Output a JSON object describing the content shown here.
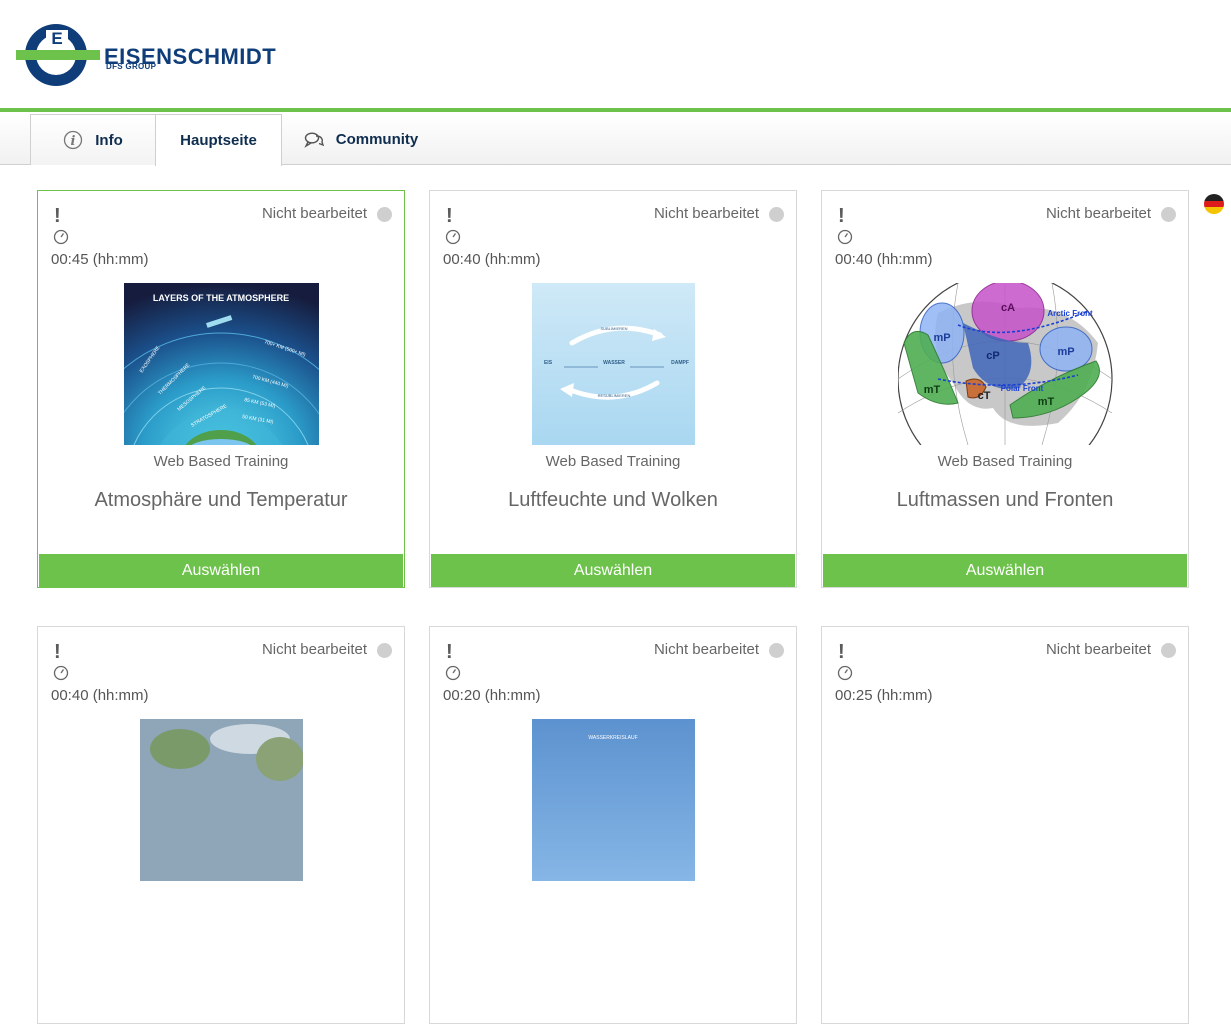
{
  "header": {
    "logo_text": "EISENSCHMIDT",
    "logo_subtext": "DFS GROUP"
  },
  "tabs": [
    {
      "label": "Info",
      "icon": "info-icon"
    },
    {
      "label": "Hauptseite",
      "icon": ""
    },
    {
      "label": "Community",
      "icon": "chat-icon"
    }
  ],
  "language_flag": "de-flag-icon",
  "cards": [
    {
      "duration": "00:45 (hh:mm)",
      "status": "Nicht bearbeitet",
      "type": "Web Based Training",
      "title": "Atmosphäre und Temperatur",
      "button": "Auswählen",
      "image_text": [
        "LAYERS OF THE ATMOSPHERE",
        "EXOSPHERE",
        "THERMOSPHERE",
        "MESOSPHERE",
        "STRATOSPHERE",
        "700+ KM (500+ MI)",
        "700 KM (440 MI)",
        "85 KM (53 MI)",
        "50 KM (31 MI)"
      ]
    },
    {
      "duration": "00:40 (hh:mm)",
      "status": "Nicht bearbeitet",
      "type": "Web Based Training",
      "title": "Luftfeuchte und Wolken",
      "button": "Auswählen",
      "image_text": [
        "SUBLIMIEREN",
        "EIS",
        "WASSER",
        "DAMPF",
        "RESUBLIMIEREN"
      ]
    },
    {
      "duration": "00:40 (hh:mm)",
      "status": "Nicht bearbeitet",
      "type": "Web Based Training",
      "title": "Luftmassen und Fronten",
      "button": "Auswählen",
      "image_text": [
        "cA",
        "mP",
        "cP",
        "mP",
        "mT",
        "cT",
        "mT",
        "Arctic Front",
        "Polar Front"
      ]
    },
    {
      "duration": "00:40 (hh:mm)",
      "status": "Nicht bearbeitet"
    },
    {
      "duration": "00:20 (hh:mm)",
      "status": "Nicht bearbeitet",
      "image_text": [
        "WASSERKREISLAUF"
      ]
    },
    {
      "duration": "00:25 (hh:mm)",
      "status": "Nicht bearbeitet"
    }
  ]
}
